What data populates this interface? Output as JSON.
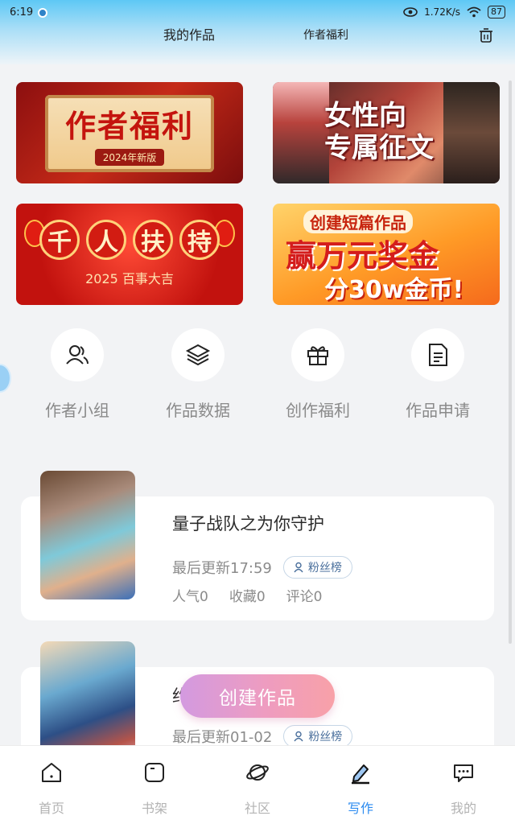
{
  "status": {
    "time": "6:19",
    "speed": "1.72K/s",
    "battery": "87"
  },
  "header": {
    "title_works": "我的作品",
    "title_welfare": "作者福利"
  },
  "banners": {
    "b1_main": "作者福利",
    "b1_tag": "2024年新版",
    "b2_line1": "女性向",
    "b2_line2": "专属征文",
    "b3_chars": [
      "千",
      "人",
      "扶",
      "持"
    ],
    "b3_sub": "2025 百事大吉",
    "b4_line1": "创建短篇作品",
    "b4_line2": "赢万元奖金",
    "b4_line3": "分30w金币!"
  },
  "features": [
    {
      "label": "作者小组",
      "icon": "group-icon"
    },
    {
      "label": "作品数据",
      "icon": "layers-icon"
    },
    {
      "label": "创作福利",
      "icon": "gift-icon"
    },
    {
      "label": "作品申请",
      "icon": "document-icon"
    }
  ],
  "works": [
    {
      "title": "量子战队之为你守护",
      "updated": "最后更新17:59",
      "fans": "粉丝榜",
      "popularity": "人气0",
      "favorites": "收藏0",
      "comments": "评论0"
    },
    {
      "title": "约",
      "updated": "最后更新01-02",
      "fans": "粉丝榜"
    }
  ],
  "create_button": "创建作品",
  "nav": [
    {
      "label": "首页",
      "icon": "home-icon"
    },
    {
      "label": "书架",
      "icon": "bookshelf-icon"
    },
    {
      "label": "社区",
      "icon": "planet-icon"
    },
    {
      "label": "写作",
      "icon": "pen-icon"
    },
    {
      "label": "我的",
      "icon": "chat-icon"
    }
  ],
  "colors": {
    "accent": "#2c8bf0",
    "muted": "#8b8b8b"
  }
}
